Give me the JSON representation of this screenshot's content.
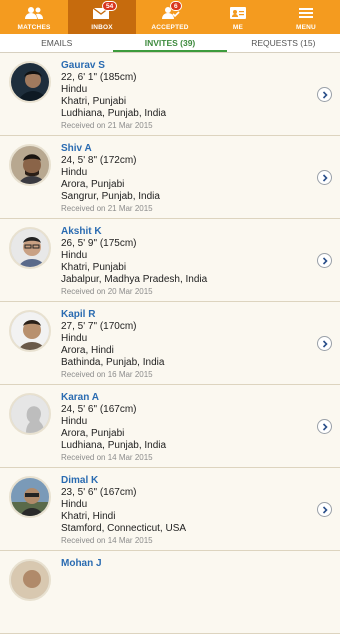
{
  "nav": {
    "items": [
      {
        "label": "MATCHES",
        "icon": "matches-icon",
        "badge": ""
      },
      {
        "label": "INBOX",
        "icon": "inbox-icon",
        "badge": "54"
      },
      {
        "label": "ACCEPTED",
        "icon": "accepted-icon",
        "badge": "6"
      },
      {
        "label": "ME",
        "icon": "me-icon",
        "badge": ""
      },
      {
        "label": "MENU",
        "icon": "menu-icon",
        "badge": ""
      }
    ],
    "active_index": 1
  },
  "tabs": [
    {
      "label": "EMAILS"
    },
    {
      "label": "INVITES (39)"
    },
    {
      "label": "REQUESTS (15)"
    }
  ],
  "active_tab": 1,
  "profiles": [
    {
      "name": "Gaurav S",
      "age_height": "22, 6' 1\" (185cm)",
      "religion": "Hindu",
      "community": "Khatri, Punjabi",
      "location": "Ludhiana, Punjab, India",
      "received": "Received on 21 Mar 2015"
    },
    {
      "name": "Shiv A",
      "age_height": "24, 5' 8\" (172cm)",
      "religion": "Hindu",
      "community": "Arora, Punjabi",
      "location": "Sangrur, Punjab, India",
      "received": "Received on 21 Mar 2015"
    },
    {
      "name": "Akshit K",
      "age_height": "26, 5' 9\" (175cm)",
      "religion": "Hindu",
      "community": "Khatri, Punjabi",
      "location": "Jabalpur, Madhya Pradesh, India",
      "received": "Received on 20 Mar 2015"
    },
    {
      "name": "Kapil R",
      "age_height": "27, 5' 7\" (170cm)",
      "religion": "Hindu",
      "community": "Arora, Hindi",
      "location": "Bathinda, Punjab, India",
      "received": "Received on 16 Mar 2015"
    },
    {
      "name": "Karan A",
      "age_height": "24, 5' 6\" (167cm)",
      "religion": "Hindu",
      "community": "Arora, Punjabi",
      "location": "Ludhiana, Punjab, India",
      "received": "Received on 14 Mar 2015"
    },
    {
      "name": "Dimal K",
      "age_height": "23, 5' 6\" (167cm)",
      "religion": "Hindu",
      "community": "Khatri, Hindi",
      "location": "Stamford, Connecticut, USA",
      "received": "Received on 14 Mar 2015"
    },
    {
      "name": "Mohan J",
      "age_height": "",
      "religion": "",
      "community": "",
      "location": "",
      "received": ""
    }
  ],
  "colors": {
    "brand": "#f49b1f",
    "brand_active": "#c66b0d",
    "name_link": "#2a6bb1",
    "active_tab": "#3d8a3d"
  }
}
